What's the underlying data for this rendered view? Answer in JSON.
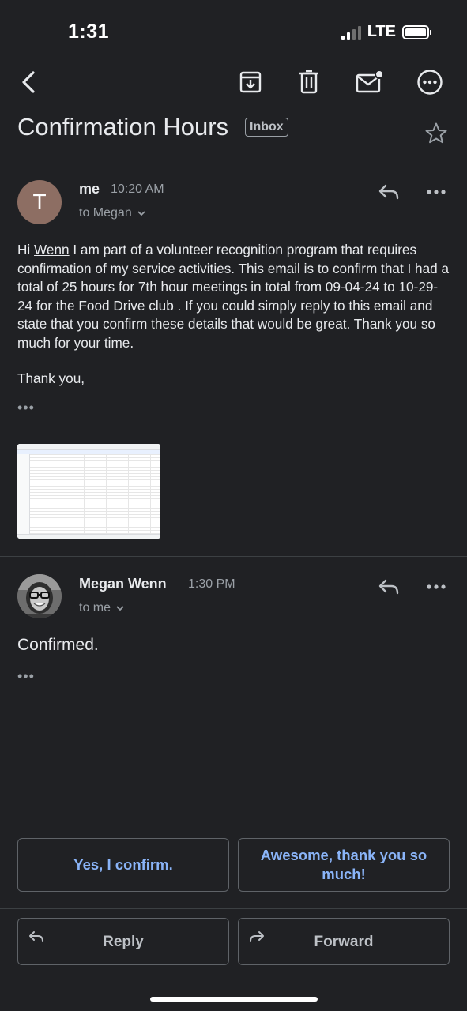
{
  "status_bar": {
    "time": "1:31",
    "network": "LTE"
  },
  "toolbar": {
    "back_icon": "chevron-left-icon",
    "archive_icon": "archive-icon",
    "delete_icon": "trash-icon",
    "mark_unread_icon": "mail-unread-icon",
    "more_icon": "more-circle-icon"
  },
  "subject": "Confirmation Hours",
  "label_badge": "Inbox",
  "messages": [
    {
      "avatar_letter": "T",
      "avatar_color": "#8d6e63",
      "sender": "me",
      "time": "10:20 AM",
      "recipient": "to Megan",
      "body_prefix": "Hi ",
      "body_link": "Wenn",
      "body_rest": " I am part of a volunteer recognition program that requires confirmation of my service activities. This email is to confirm that I had a total of 25  hours for 7th hour meetings in total from 09-04-24 to 10-29-24 for the Food Drive club . If you could simply reply to this email and state that you confirm these details that would be great. Thank you so much for your time.",
      "signoff": "Thank you,",
      "collapsed_indicator": "•••"
    },
    {
      "sender": "Megan Wenn",
      "time": "1:30 PM",
      "recipient": "to me",
      "body": "Confirmed.",
      "collapsed_indicator": "•••"
    }
  ],
  "smart_replies": [
    "Yes, I confirm.",
    "Awesome, thank you so much!"
  ],
  "actions": {
    "reply": "Reply",
    "forward": "Forward"
  },
  "colors": {
    "background": "#202124",
    "accent": "#8ab4f8",
    "border": "#5f6368"
  }
}
